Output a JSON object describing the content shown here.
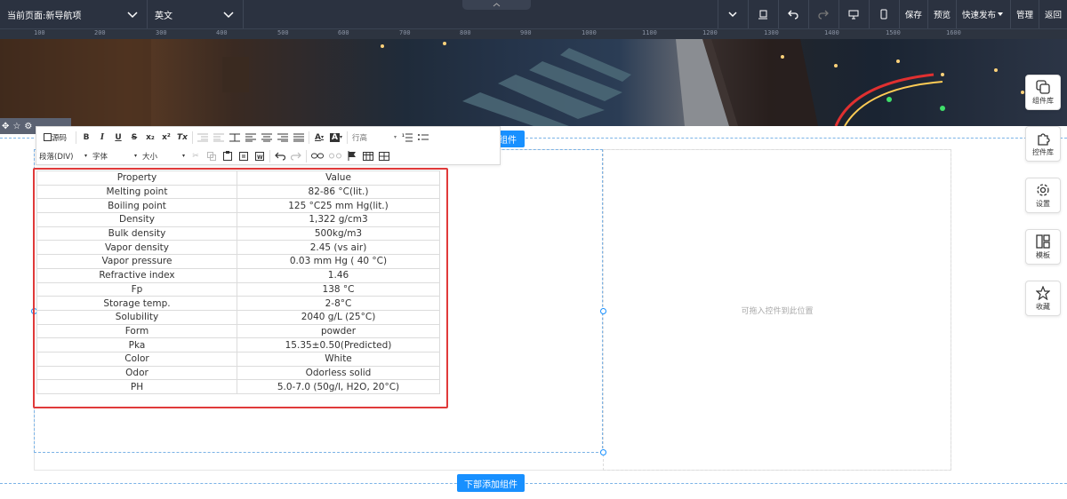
{
  "topbar": {
    "page_select": "当前页面:新导航项",
    "lang_select": "英文",
    "actions": {
      "save": "保存",
      "preview": "预览",
      "publish": "快速发布",
      "manage": "管理",
      "back": "返回"
    }
  },
  "ruler": {
    "ticks": [
      "100",
      "200",
      "300",
      "400",
      "500",
      "600",
      "700",
      "800",
      "900",
      "1000",
      "1100",
      "1200",
      "1300",
      "1400",
      "1500",
      "1600"
    ]
  },
  "editor_toolbar": {
    "source_label": "源码",
    "bold": "B",
    "italic": "I",
    "underline": "U",
    "strike": "S",
    "subscript": "x₂",
    "superscript": "x²",
    "clear_format": "Tx",
    "font_color": "A",
    "bg_color": "A",
    "line_height": "行高",
    "paragraph": "段落(DIV)",
    "font_family": "字体",
    "font_size": "大小"
  },
  "add_buttons": {
    "top": "组件",
    "bottom": "下部添加组件"
  },
  "placeholder_text": "可拖入控件到此位置",
  "right_dock": [
    {
      "icon": "component-library-icon",
      "label": "组件库"
    },
    {
      "icon": "puzzle-icon",
      "label": "控件库"
    },
    {
      "icon": "gear-icon",
      "label": "设置"
    },
    {
      "icon": "template-icon",
      "label": "模板"
    },
    {
      "icon": "star-icon",
      "label": "收藏"
    }
  ],
  "table": {
    "headers": [
      "Property",
      "Value"
    ],
    "rows": [
      [
        "Melting point",
        "82-86 °C(lit.)"
      ],
      [
        "Boiling point",
        "125 °C25 mm Hg(lit.)"
      ],
      [
        "Density",
        "1,322 g/cm3"
      ],
      [
        "Bulk density",
        "500kg/m3"
      ],
      [
        "Vapor density",
        "2.45 (vs air)"
      ],
      [
        "Vapor pressure",
        "0.03 mm Hg ( 40 °C)"
      ],
      [
        "Refractive index",
        "1.46"
      ],
      [
        "Fp",
        "138 °C"
      ],
      [
        "Storage temp.",
        "2-8°C"
      ],
      [
        "Solubility",
        "2040 g/L (25°C)"
      ],
      [
        "Form",
        "powder"
      ],
      [
        "Pka",
        "15.35±0.50(Predicted)"
      ],
      [
        "Color",
        "White"
      ],
      [
        "Odor",
        "Odorless solid"
      ],
      [
        "PH",
        "5.0-7.0 (50g/l, H2O, 20°C)"
      ]
    ]
  },
  "colors": {
    "topbar_bg": "#2b3240",
    "accent": "#1890ff",
    "selection_frame": "#e03a3a"
  }
}
